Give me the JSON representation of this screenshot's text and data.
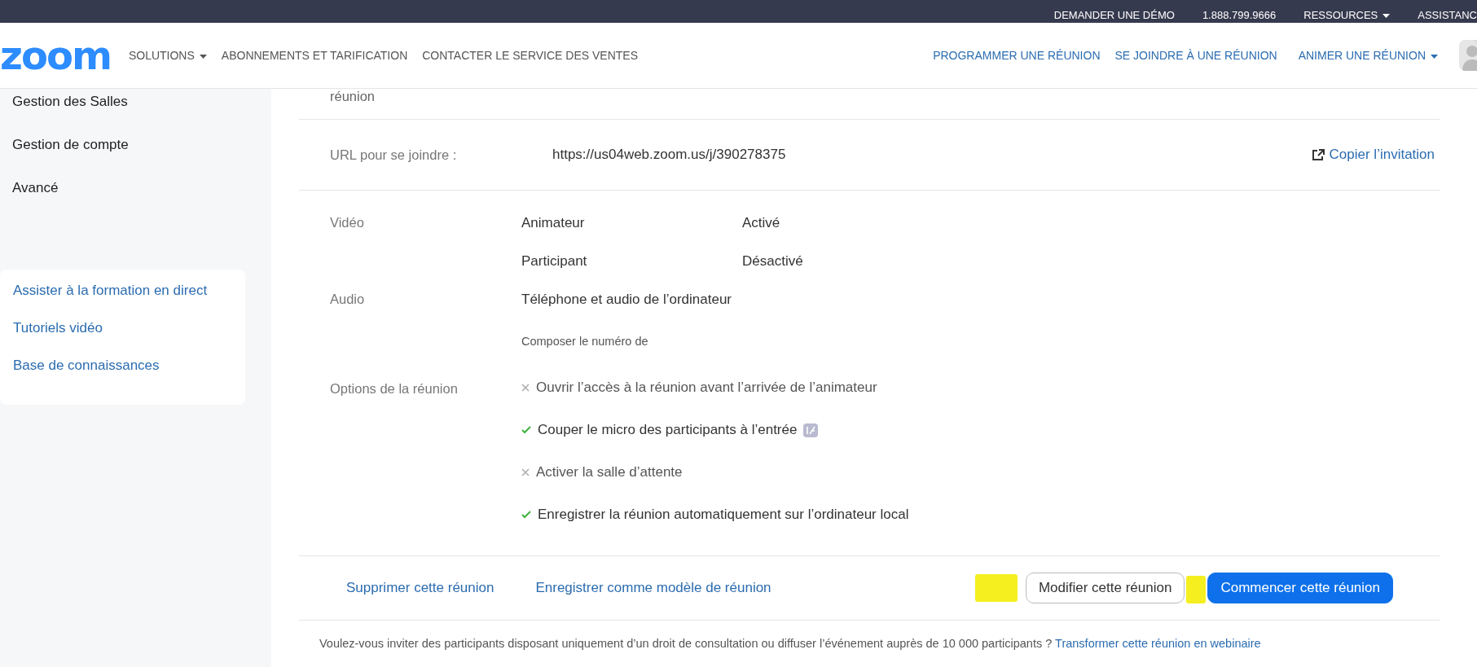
{
  "top_bar": {
    "links": [
      {
        "label": "DEMANDER UNE DÉMO",
        "dropdown": false
      },
      {
        "label": "1.888.799.9666",
        "dropdown": false
      },
      {
        "label": "RESSOURCES",
        "dropdown": true
      },
      {
        "label": "ASSISTANC",
        "dropdown": false
      }
    ]
  },
  "nav": {
    "logo": "zoom",
    "left": [
      {
        "label": "SOLUTIONS",
        "dropdown": true
      },
      {
        "label": "ABONNEMENTS ET TARIFICATION",
        "dropdown": false
      },
      {
        "label": "CONTACTER LE SERVICE DES VENTES",
        "dropdown": false
      }
    ],
    "right": [
      {
        "label": "PROGRAMMER UNE RÉUNION",
        "dropdown": false
      },
      {
        "label": "SE JOINDRE À UNE RÉUNION",
        "dropdown": false
      },
      {
        "label": "ANIMER UNE RÉUNION",
        "dropdown": true
      }
    ]
  },
  "sidebar": {
    "items": [
      "Gestion des Salles",
      "Gestion de compte",
      "Avancé"
    ],
    "help_links": [
      "Assister à la formation en direct",
      "Tutoriels vidéo",
      "Base de connaissances"
    ]
  },
  "meeting": {
    "partial_label": "réunion",
    "join_url": {
      "label": "URL pour se joindre :",
      "value": "https://us04web.zoom.us/j/390278375",
      "action": "Copier l’invitation"
    },
    "video": {
      "label": "Vidéo",
      "rows": [
        {
          "who": "Animateur",
          "state": "Activé"
        },
        {
          "who": "Participant",
          "state": "Désactivé"
        }
      ]
    },
    "audio": {
      "label": "Audio",
      "value": "Téléphone et audio de l’ordinateur",
      "note": "Composer le numéro de"
    },
    "options": {
      "label": "Options de la réunion",
      "items": [
        {
          "text": "Ouvrir l’accès à la réunion avant l’arrivée de l’animateur",
          "checked": false,
          "badge": false
        },
        {
          "text": "Couper le micro des participants à l’entrée",
          "checked": true,
          "badge": true
        },
        {
          "text": "Activer la salle d’attente",
          "checked": false,
          "badge": false
        },
        {
          "text": "Enregistrer la réunion automatiquement sur l’ordinateur local",
          "checked": true,
          "badge": false
        }
      ]
    },
    "actions": {
      "links": [
        "Supprimer cette réunion",
        "Enregistrer comme modèle de réunion"
      ],
      "edit": "Modifier cette réunion",
      "start": "Commencer cette réunion"
    },
    "footer": {
      "text": "Voulez-vous inviter des participants disposant uniquement d’un droit de consultation ou diffuser l’événement auprès de 10 000 participants ?",
      "link": "Transformer cette réunion en webinaire"
    }
  }
}
